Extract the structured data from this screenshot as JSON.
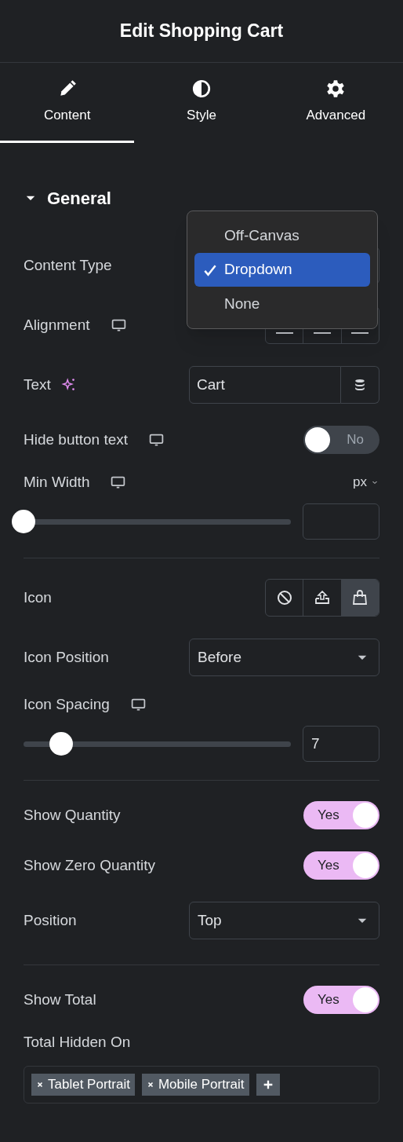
{
  "header": {
    "title": "Edit Shopping Cart"
  },
  "tabs": [
    {
      "label": "Content",
      "selected": true
    },
    {
      "label": "Style",
      "selected": false
    },
    {
      "label": "Advanced",
      "selected": false
    }
  ],
  "section": {
    "title": "General",
    "expanded": true
  },
  "controls": [
    {
      "kind": "select",
      "label": "Content Type"
    },
    {
      "kind": "alignment",
      "label": "Alignment",
      "responsive": true
    },
    {
      "kind": "text",
      "label": "Text",
      "ai": true,
      "value": "Cart"
    },
    {
      "kind": "switch",
      "label": "Hide button text",
      "responsive": true,
      "on": false,
      "text": "No"
    },
    {
      "kind": "slider",
      "label": "Min Width",
      "responsive": true,
      "unit": "px",
      "level": 0
    },
    {
      "kind": "divider"
    },
    {
      "kind": "icons",
      "label": "Icon",
      "options": [
        {
          "selected": false
        },
        {
          "selected": false
        },
        {
          "selected": true
        }
      ]
    },
    {
      "kind": "select",
      "label": "Icon Position",
      "value": "Before"
    },
    {
      "kind": "slider",
      "label": "Icon Spacing",
      "responsive": true,
      "level": 0.14,
      "value": "7"
    },
    {
      "kind": "divider"
    },
    {
      "kind": "switch",
      "label": "Show Quantity",
      "on": true,
      "text": "Yes"
    },
    {
      "kind": "switch",
      "label": "Show Zero Quantity",
      "on": true,
      "text": "Yes"
    },
    {
      "kind": "select",
      "label": "Position",
      "value": "Top"
    },
    {
      "kind": "divider"
    },
    {
      "kind": "switch",
      "label": "Show Total",
      "on": true,
      "text": "Yes"
    },
    {
      "kind": "tags",
      "label": "Total Hidden On",
      "tags": [
        "Tablet Portrait",
        "Mobile Portrait"
      ]
    }
  ],
  "popup": {
    "options": [
      {
        "label": "Off-Canvas",
        "selected": false
      },
      {
        "label": "Dropdown",
        "selected": true
      },
      {
        "label": "None",
        "selected": false
      }
    ]
  }
}
